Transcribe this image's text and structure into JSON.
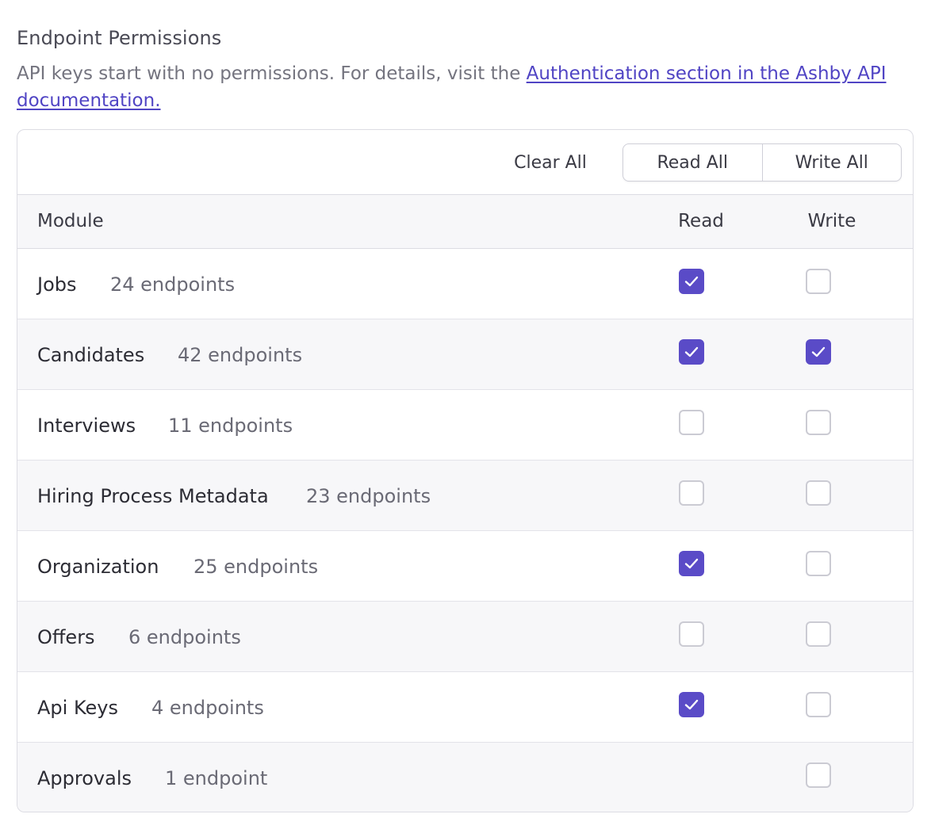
{
  "section": {
    "title": "Endpoint Permissions",
    "description_prefix": "API keys start with no permissions. For details, visit the ",
    "link_text": "Authentication section in the Ashby API documentation."
  },
  "toolbar": {
    "clear_all_label": "Clear All",
    "read_all_label": "Read All",
    "write_all_label": "Write All"
  },
  "table": {
    "headers": {
      "module": "Module",
      "read": "Read",
      "write": "Write"
    },
    "rows": [
      {
        "name": "Jobs",
        "count": "24 endpoints",
        "read": true,
        "write": false
      },
      {
        "name": "Candidates",
        "count": "42 endpoints",
        "read": true,
        "write": true
      },
      {
        "name": "Interviews",
        "count": "11 endpoints",
        "read": false,
        "write": false
      },
      {
        "name": "Hiring Process Metadata",
        "count": "23 endpoints",
        "read": false,
        "write": false
      },
      {
        "name": "Organization",
        "count": "25 endpoints",
        "read": true,
        "write": false
      },
      {
        "name": "Offers",
        "count": "6 endpoints",
        "read": false,
        "write": false
      },
      {
        "name": "Api Keys",
        "count": "4 endpoints",
        "read": true,
        "write": false
      },
      {
        "name": "Approvals",
        "count": "1 endpoint",
        "read": null,
        "write": false
      }
    ]
  },
  "colors": {
    "accent": "#5a4bc7",
    "link": "#5044c4"
  }
}
